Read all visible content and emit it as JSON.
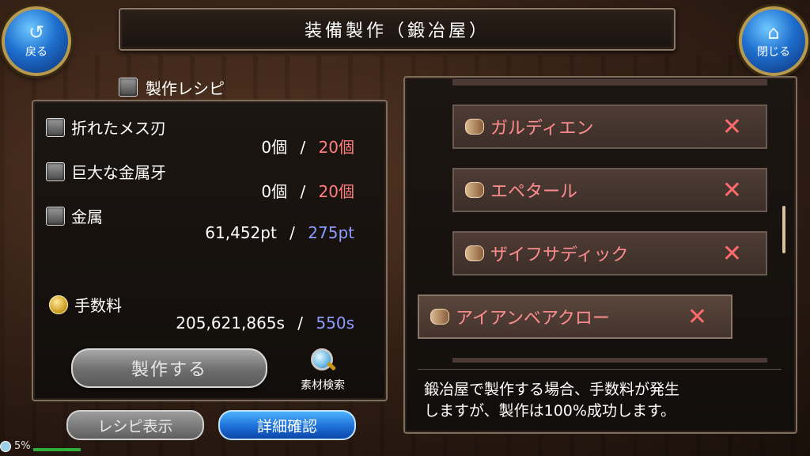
{
  "header": {
    "title": "装備製作（鍛冶屋）",
    "back_label": "戻る",
    "close_label": "閉じる"
  },
  "recipe": {
    "section_title": "製作レシピ",
    "materials": [
      {
        "name": "折れたメス刃",
        "owned": "0個",
        "separator": "/",
        "required": "20個"
      },
      {
        "name": "巨大な金属牙",
        "owned": "0個",
        "separator": "/",
        "required": "20個"
      },
      {
        "name": "金属",
        "owned": "61,452pt",
        "separator": "/",
        "required": "275pt"
      }
    ],
    "fee": {
      "name": "手数料",
      "owned": "205,621,865s",
      "separator": "/",
      "required": "550s"
    },
    "craft_button": "製作する",
    "search_label": "素材検索",
    "recipe_button": "レシピ表示",
    "detail_button": "詳細確認"
  },
  "status": {
    "battery": "5%"
  },
  "list": {
    "items": [
      {
        "name": "ガルディエン",
        "mark": "✕"
      },
      {
        "name": "エペタール",
        "mark": "✕"
      },
      {
        "name": "ザイフサディック",
        "mark": "✕"
      },
      {
        "name": "アイアンベアクロー",
        "mark": "✕"
      }
    ]
  },
  "info": {
    "line1": "鍛冶屋で製作する場合、手数料が発生",
    "line2": "しますが、製作は100%成功します。"
  },
  "colors": {
    "required_red": "#ff7e7e",
    "required_blue": "#8e9bff",
    "item_red": "#ff8d8d"
  }
}
